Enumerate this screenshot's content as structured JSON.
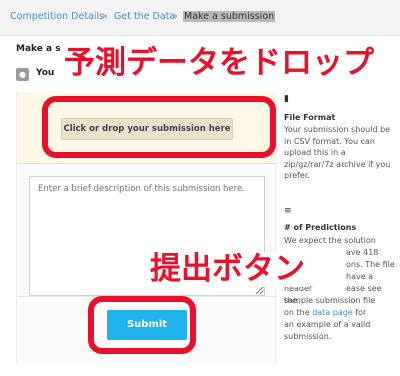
{
  "breadcrumb": {
    "items": [
      "Competition Details",
      "Get the Data"
    ],
    "separator": "»",
    "current": "Make a submission"
  },
  "page": {
    "title": "Make a s",
    "step_label": "You"
  },
  "upload": {
    "drop_label": "Click or drop your submission here"
  },
  "description": {
    "placeholder": "Enter a brief description of this submission here."
  },
  "submit": {
    "label": "Submit"
  },
  "sidebar": {
    "file_format": {
      "title": "File Format",
      "text": "Your submission should be in CSV format. You can upload this in a zip/gz/rar/7z archive if you prefer."
    },
    "predictions": {
      "title": "# of Predictions",
      "line1": "We expect the solution",
      "line2": "ave 418",
      "line3": "ons. The file",
      "line4": "have a header",
      "line5": "ease see the",
      "line6": "sample submission file",
      "line7_prefix": "on the",
      "link": "data page",
      "line7_suffix": "for",
      "line8": "an example of a valid",
      "line9": "submission."
    }
  },
  "annotations": {
    "drop": "予測データをドロップ",
    "submit": "提出ボタン"
  },
  "colors": {
    "highlight": "#e8102a",
    "submit": "#1fb3ec",
    "link": "#4a8cc7"
  }
}
